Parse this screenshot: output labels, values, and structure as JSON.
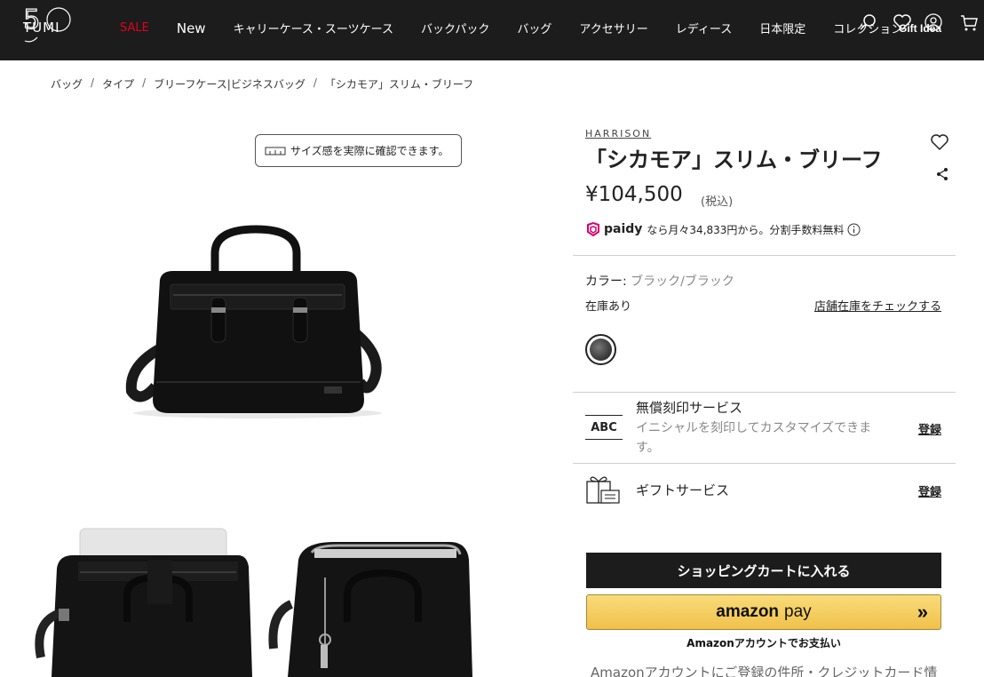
{
  "header": {
    "logo_text": "TUMI 50",
    "nav": [
      "SALE",
      "New",
      "キャリーケース・スーツケース",
      "バックパック",
      "バッグ",
      "アクセサリー",
      "レディース",
      "日本限定",
      "コレクション"
    ],
    "gift_idea_label": "Gift Idea",
    "icons": [
      "search-icon",
      "wishlist-icon",
      "account-icon",
      "cart-icon"
    ]
  },
  "breadcrumb": [
    "バッグ",
    "タイプ",
    "ブリーフケース|ビジネスバッグ",
    "「シカモア」スリム・ブリーフ"
  ],
  "gallery": {
    "size_button_label": "サイズ感を実際に確認できます。"
  },
  "product": {
    "brand": "HARRISON",
    "title": "「シカモア」スリム・ブリーフ",
    "price": "¥104,500",
    "tax_note": "(税込)",
    "paidy_logo": "paidy",
    "paidy_text": "なら月々34,833円から。分割手数料無料",
    "color_label": "カラー:",
    "color_value": "ブラック/ブラック",
    "stock_status": "在庫あり",
    "store_stock_link": "店舗在庫をチェックする"
  },
  "services": {
    "engraving_icon": "ABC",
    "engraving_title": "無償刻印サービス",
    "engraving_desc": "イニシャルを刻印してカスタマイズできます。",
    "engraving_register": "登録",
    "gift_title": "ギフトサービス",
    "gift_register": "登録"
  },
  "actions": {
    "cart_button": "ショッピングカートに入れる",
    "amazon_logo": "amazon",
    "amazon_pay": "pay",
    "amazon_arrows": "»",
    "amazon_sub": "Amazonアカウントでお支払い",
    "amazon_note": "Amazonアカウントにご登録の件所・クレジットカード情"
  },
  "colors": {
    "header_bg": "#1c1c1c",
    "sale_red": "#e2001a",
    "amazon_yellow": "#f0c14b",
    "paidy_pink": "#d6006f"
  }
}
